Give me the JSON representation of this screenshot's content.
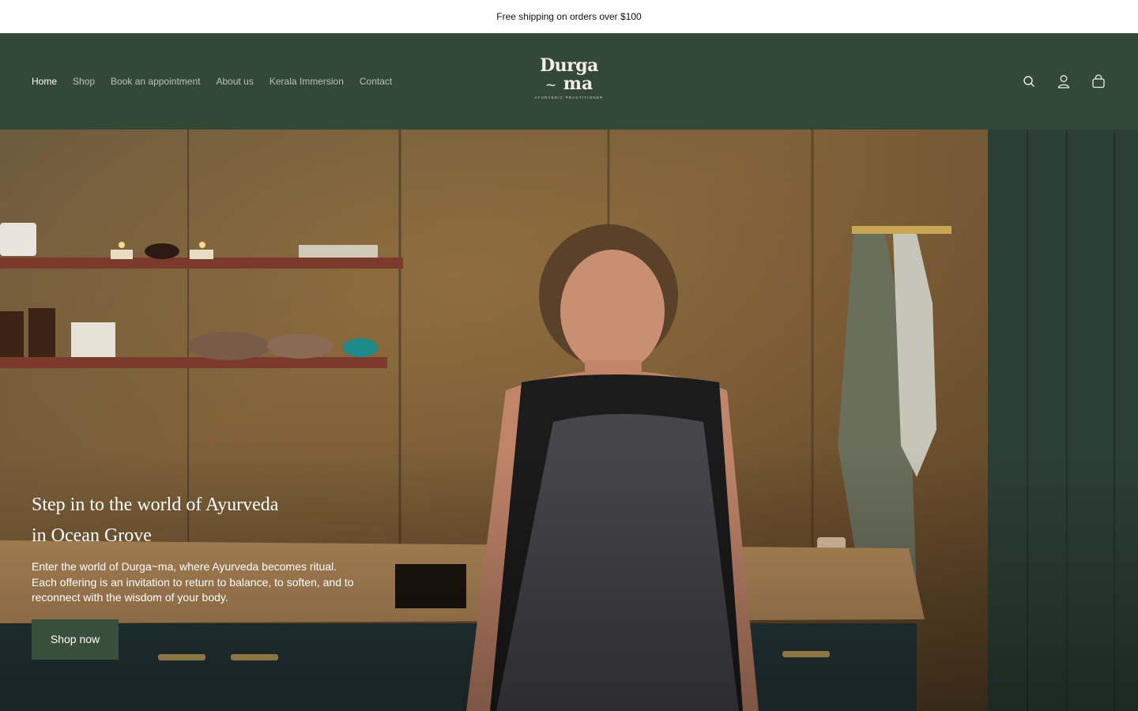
{
  "announcement": {
    "text": "Free shipping on orders over $100"
  },
  "nav": {
    "items": [
      {
        "label": "Home",
        "active": true
      },
      {
        "label": "Shop",
        "active": false
      },
      {
        "label": "Book an appointment",
        "active": false
      },
      {
        "label": "About us",
        "active": false
      },
      {
        "label": "Kerala Immersion",
        "active": false
      },
      {
        "label": "Contact",
        "active": false
      }
    ]
  },
  "logo": {
    "line1": "Durga",
    "tilde": "~",
    "line2": "ma",
    "tagline": "AYURVEDIC PRACTITIONER"
  },
  "header_icons": [
    "search-icon",
    "account-icon",
    "cart-icon"
  ],
  "hero": {
    "title_line1": "Step in to the world of Ayurveda",
    "title_line2": "in Ocean Grove",
    "text": "Enter the world of Durga~ma, where Ayurveda becomes ritual. Each offering is an invitation to return to balance, to soften, and to reconnect with the wisdom of your body.",
    "button_label": "Shop now"
  },
  "colors": {
    "header_bg": "#344837",
    "button_bg": "#3a4f3b",
    "announcement_bg": "#ffffff"
  }
}
